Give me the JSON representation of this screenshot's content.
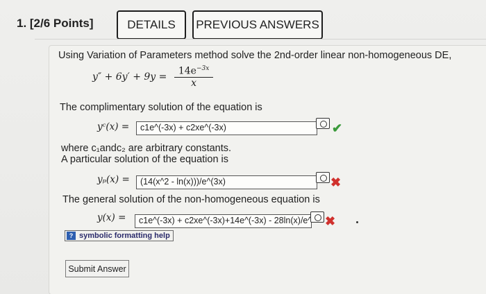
{
  "header": {
    "question_number": "1. [2/6 Points]",
    "details_label": "DETAILS",
    "previous_answers_label": "PREVIOUS ANSWERS"
  },
  "problem": {
    "prompt": "Using Variation of Parameters method solve the 2nd-order linear non-homogeneous DE,",
    "equation_lhs": "y″ + 6y′ + 9y =",
    "equation_numerator": "14e",
    "equation_numerator_exp": "−3x",
    "equation_denominator": "x"
  },
  "complementary": {
    "intro": "The complimentary solution of the equation is",
    "label": "yᶜ(x) =",
    "value": "c1e^(-3x) + c2xe^(-3x)",
    "status": "correct",
    "constants_note": "where c₁andc₂ are arbitrary constants."
  },
  "particular": {
    "intro": "A particular solution of the equation is",
    "label": "yₚ(x) =",
    "value": "(14(x^2 - ln(x)))/e^(3x)",
    "status": "incorrect"
  },
  "general": {
    "intro": "The general solution of the non-homogeneous equation is",
    "label": "y(x) =",
    "value": "c1e^(-3x) + c2xe^(-3x)+14e^(-3x) - 28ln(x)/e^(-",
    "status": "incorrect"
  },
  "help": {
    "label": "symbolic formatting help"
  },
  "submit": {
    "label": "Submit Answer"
  },
  "icons": {
    "preview": "preview-eye-icon",
    "check": "checkmark-icon",
    "cross": "x-mark-icon",
    "help": "help-icon"
  },
  "colors": {
    "correct": "#3a9a3a",
    "incorrect": "#d0312d"
  }
}
